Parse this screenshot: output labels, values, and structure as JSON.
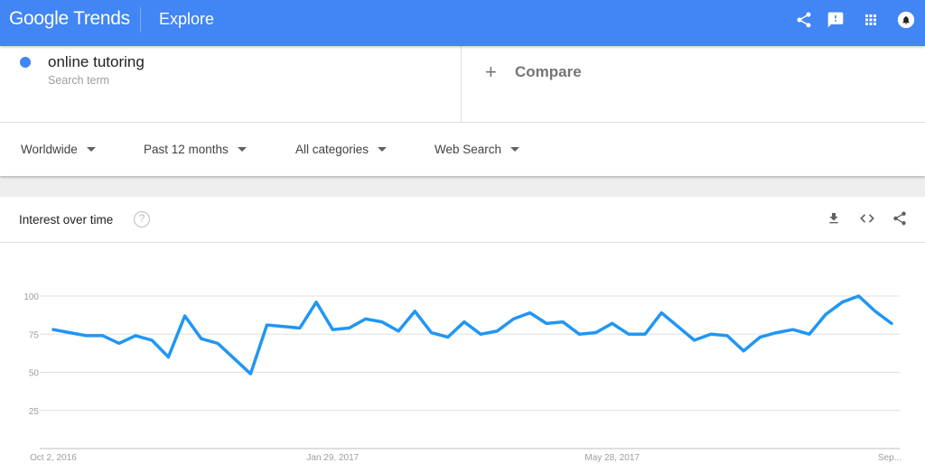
{
  "header": {
    "logo_text": "Google Trends",
    "section": "Explore",
    "icons": [
      "share-icon",
      "feedback-icon",
      "apps-icon",
      "notifications-icon"
    ],
    "color": "#4285f4"
  },
  "search": {
    "term": "online tutoring",
    "term_subtitle": "Search term",
    "term_color": "#4285f4",
    "compare_label": "Compare"
  },
  "filters": {
    "region": "Worldwide",
    "time": "Past 12 months",
    "category": "All categories",
    "property": "Web Search"
  },
  "card": {
    "title": "Interest over time",
    "help": "?",
    "actions": [
      "download-icon",
      "embed-icon",
      "share-icon"
    ]
  },
  "chart_data": {
    "type": "line",
    "title": "Interest over time",
    "xlabel": "",
    "ylabel": "",
    "ylim": [
      0,
      100
    ],
    "yticks": [
      25,
      50,
      75,
      100
    ],
    "grid": true,
    "line_color": "#2196f3",
    "x_tick_labels": [
      {
        "index": 0,
        "label": "Oct 2, 2016"
      },
      {
        "index": 17,
        "label": "Jan 29, 2017"
      },
      {
        "index": 34,
        "label": "May 28, 2017"
      },
      {
        "index": 51,
        "label": "Sep..."
      }
    ],
    "series": [
      {
        "name": "online tutoring",
        "values": [
          78,
          76,
          74,
          74,
          69,
          74,
          71,
          60,
          87,
          72,
          69,
          59,
          49,
          81,
          80,
          79,
          96,
          78,
          79,
          85,
          83,
          77,
          90,
          76,
          73,
          83,
          75,
          77,
          85,
          89,
          82,
          83,
          75,
          76,
          82,
          75,
          75,
          89,
          80,
          71,
          75,
          74,
          64,
          73,
          76,
          78,
          75,
          88,
          96,
          100,
          90,
          82
        ]
      }
    ]
  }
}
